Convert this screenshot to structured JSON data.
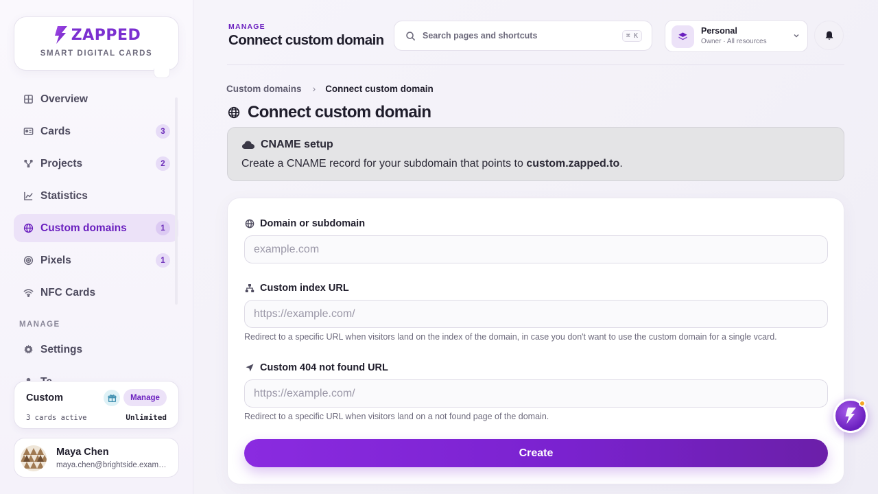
{
  "brand": {
    "name": "ZAPPED",
    "tagline": "SMART DIGITAL CARDS",
    "color": "#7b2fd0"
  },
  "sidebar": {
    "items": [
      {
        "label": "Overview",
        "icon": "grid-icon",
        "badge": null,
        "active": false
      },
      {
        "label": "Cards",
        "icon": "id-card-icon",
        "badge": "3",
        "active": false
      },
      {
        "label": "Projects",
        "icon": "project-nodes-icon",
        "badge": "2",
        "active": false
      },
      {
        "label": "Statistics",
        "icon": "chart-line-icon",
        "badge": null,
        "active": false
      },
      {
        "label": "Custom domains",
        "icon": "globe-icon",
        "badge": "1",
        "active": true
      },
      {
        "label": "Pixels",
        "icon": "target-icon",
        "badge": "1",
        "active": false
      },
      {
        "label": "NFC Cards",
        "icon": "wifi-icon",
        "badge": null,
        "active": false
      }
    ],
    "section_manage": "MANAGE",
    "manage_items": [
      {
        "label": "Settings",
        "icon": "gear-icon"
      },
      {
        "label": "Te",
        "icon": "user-icon"
      }
    ]
  },
  "plan": {
    "name": "Custom",
    "manage_label": "Manage",
    "active_text": "3 cards active",
    "limit_text": "Unlimited"
  },
  "user": {
    "name": "Maya Chen",
    "email": "maya.chen@brightside.example.com"
  },
  "header": {
    "kicker": "MANAGE",
    "title": "Connect custom domain",
    "search_placeholder": "Search pages and shortcuts",
    "search_shortcut": "⌘ K",
    "workspace_name": "Personal",
    "workspace_sub": "Owner · All resources"
  },
  "breadcrumb": {
    "parent": "Custom domains",
    "separator": "›",
    "current": "Connect custom domain"
  },
  "page": {
    "title": "Connect custom domain"
  },
  "alert": {
    "title": "CNAME setup",
    "body_prefix": "Create a CNAME record for your subdomain that points to ",
    "body_target": "custom.zapped.to",
    "body_suffix": "."
  },
  "form": {
    "domain_label": "Domain or subdomain",
    "domain_placeholder": "example.com",
    "domain_value": "",
    "index_label": "Custom index URL",
    "index_placeholder": "https://example.com/",
    "index_value": "",
    "index_help": "Redirect to a specific URL when visitors land on the index of the domain, in case you don't want to use the custom domain for a single vcard.",
    "notfound_label": "Custom 404 not found URL",
    "notfound_placeholder": "https://example.com/",
    "notfound_value": "",
    "notfound_help": "Redirect to a specific URL when visitors land on a not found page of the domain.",
    "submit_label": "Create"
  },
  "colors": {
    "accent": "#7a22cf",
    "accent_soft": "#ece2f8",
    "alert_bg": "#e4e4e6",
    "notification_dot": "#f5a623"
  }
}
